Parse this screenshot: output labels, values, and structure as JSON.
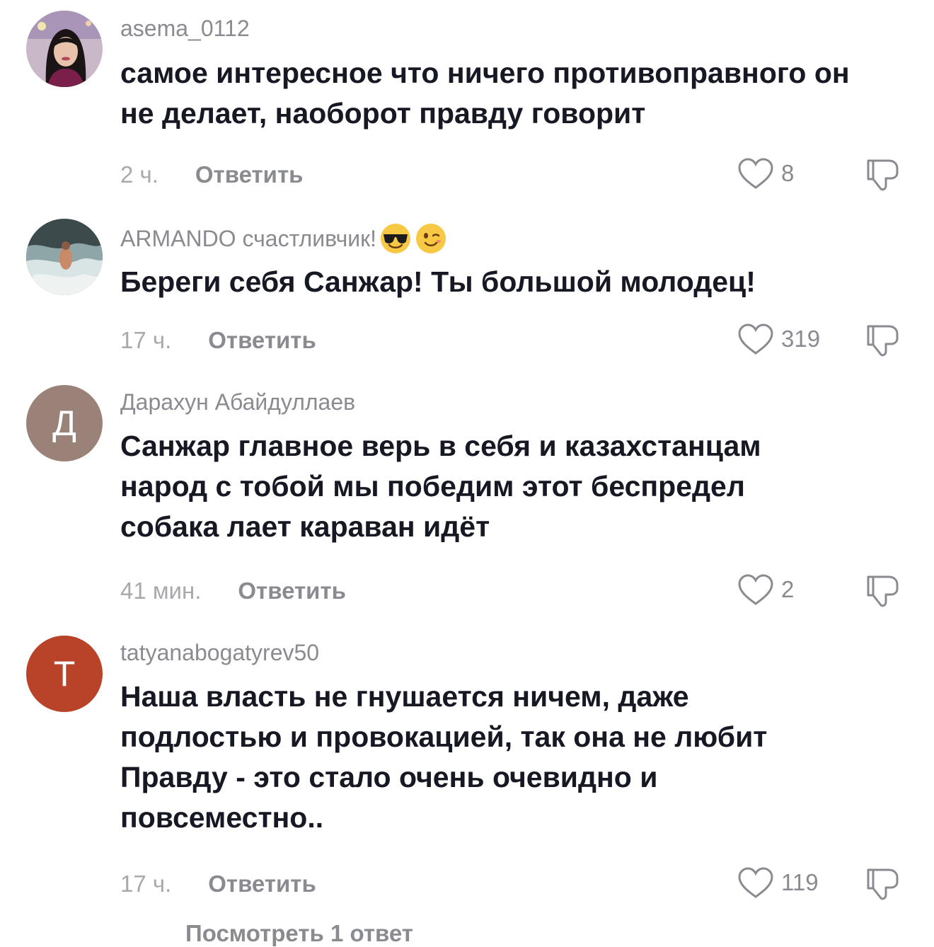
{
  "comments": [
    {
      "username": "asema_0112",
      "text": "самое интересное что ничего противоправного он не делает, наоборот правду говорит",
      "time": "2 ч.",
      "reply_label": "Ответить",
      "likes": "8",
      "avatar": "photo"
    },
    {
      "username": "ARMANDO счастливчик!",
      "username_emojis": [
        "sunglasses-emoji",
        "wink-emoji"
      ],
      "text": "Береги себя Санжар! Ты большой молодец!",
      "time": "17 ч.",
      "reply_label": "Ответить",
      "likes": "319",
      "avatar": "photo"
    },
    {
      "username": "Дарахун Абайдуллаев",
      "text": "Санжар главное верь в себя и казахстанцам народ с тобой мы победим этот беспредел собака лает караван идёт",
      "time": "41 мин.",
      "reply_label": "Ответить",
      "likes": "2",
      "avatar": "letter",
      "avatar_letter": "Д",
      "avatar_color": "#9b8279"
    },
    {
      "username": "tatyanabogatyrev50",
      "text": "Наша власть не гнушается ничем, даже подлостью и провокацией, так она не любит Правду - это стало очень очевидно и повсеместно..",
      "time": "17 ч.",
      "reply_label": "Ответить",
      "likes": "119",
      "avatar": "letter",
      "avatar_letter": "Т",
      "avatar_color": "#b84328"
    }
  ],
  "view_replies": "Посмотреть 1 ответ"
}
